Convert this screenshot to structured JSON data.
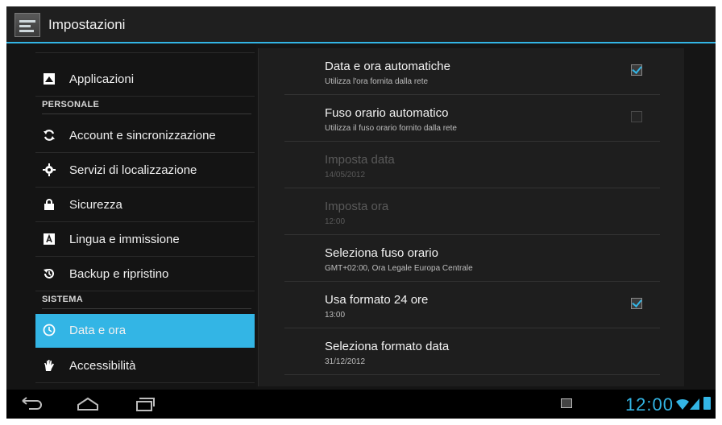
{
  "action_bar": {
    "title": "Impostazioni"
  },
  "left_list": {
    "items_top": [
      {
        "label": "Applicazioni",
        "icon": "apps-icon"
      }
    ],
    "section_personale": "PERSONALE",
    "items_personale": [
      {
        "label": "Account e sincronizzazione",
        "icon": "sync-icon"
      },
      {
        "label": "Servizi di localizzazione",
        "icon": "location-icon"
      },
      {
        "label": "Sicurezza",
        "icon": "lock-icon"
      },
      {
        "label": "Lingua e immissione",
        "icon": "keyboard-icon"
      },
      {
        "label": "Backup e ripristino",
        "icon": "backup-icon"
      }
    ],
    "section_sistema": "SISTEMA",
    "items_sistema": [
      {
        "label": "Data e ora",
        "icon": "clock-icon",
        "selected": true
      },
      {
        "label": "Accessibilità",
        "icon": "hand-icon"
      }
    ]
  },
  "detail": {
    "rows": [
      {
        "title": "Data e ora automatiche",
        "subtitle": "Utilizza l'ora fornita dalla rete",
        "checkbox": true,
        "checked": true,
        "enabled": true
      },
      {
        "title": "Fuso orario automatico",
        "subtitle": "Utilizza il fuso orario fornito dalla rete",
        "checkbox": true,
        "checked": false,
        "enabled": true
      },
      {
        "title": "Imposta data",
        "subtitle": "14/05/2012",
        "checkbox": false,
        "enabled": false
      },
      {
        "title": "Imposta ora",
        "subtitle": "12:00",
        "checkbox": false,
        "enabled": false
      },
      {
        "title": "Seleziona fuso orario",
        "subtitle": "GMT+02:00, Ora Legale Europa Centrale",
        "checkbox": false,
        "enabled": true
      },
      {
        "title": "Usa formato 24 ore",
        "subtitle": "13:00",
        "checkbox": true,
        "checked": true,
        "enabled": true
      },
      {
        "title": "Seleziona formato data",
        "subtitle": "31/12/2012",
        "checkbox": false,
        "enabled": true
      }
    ]
  },
  "status_bar": {
    "time": "12:00"
  },
  "colors": {
    "accent": "#33b5e5",
    "background": "#151515"
  }
}
